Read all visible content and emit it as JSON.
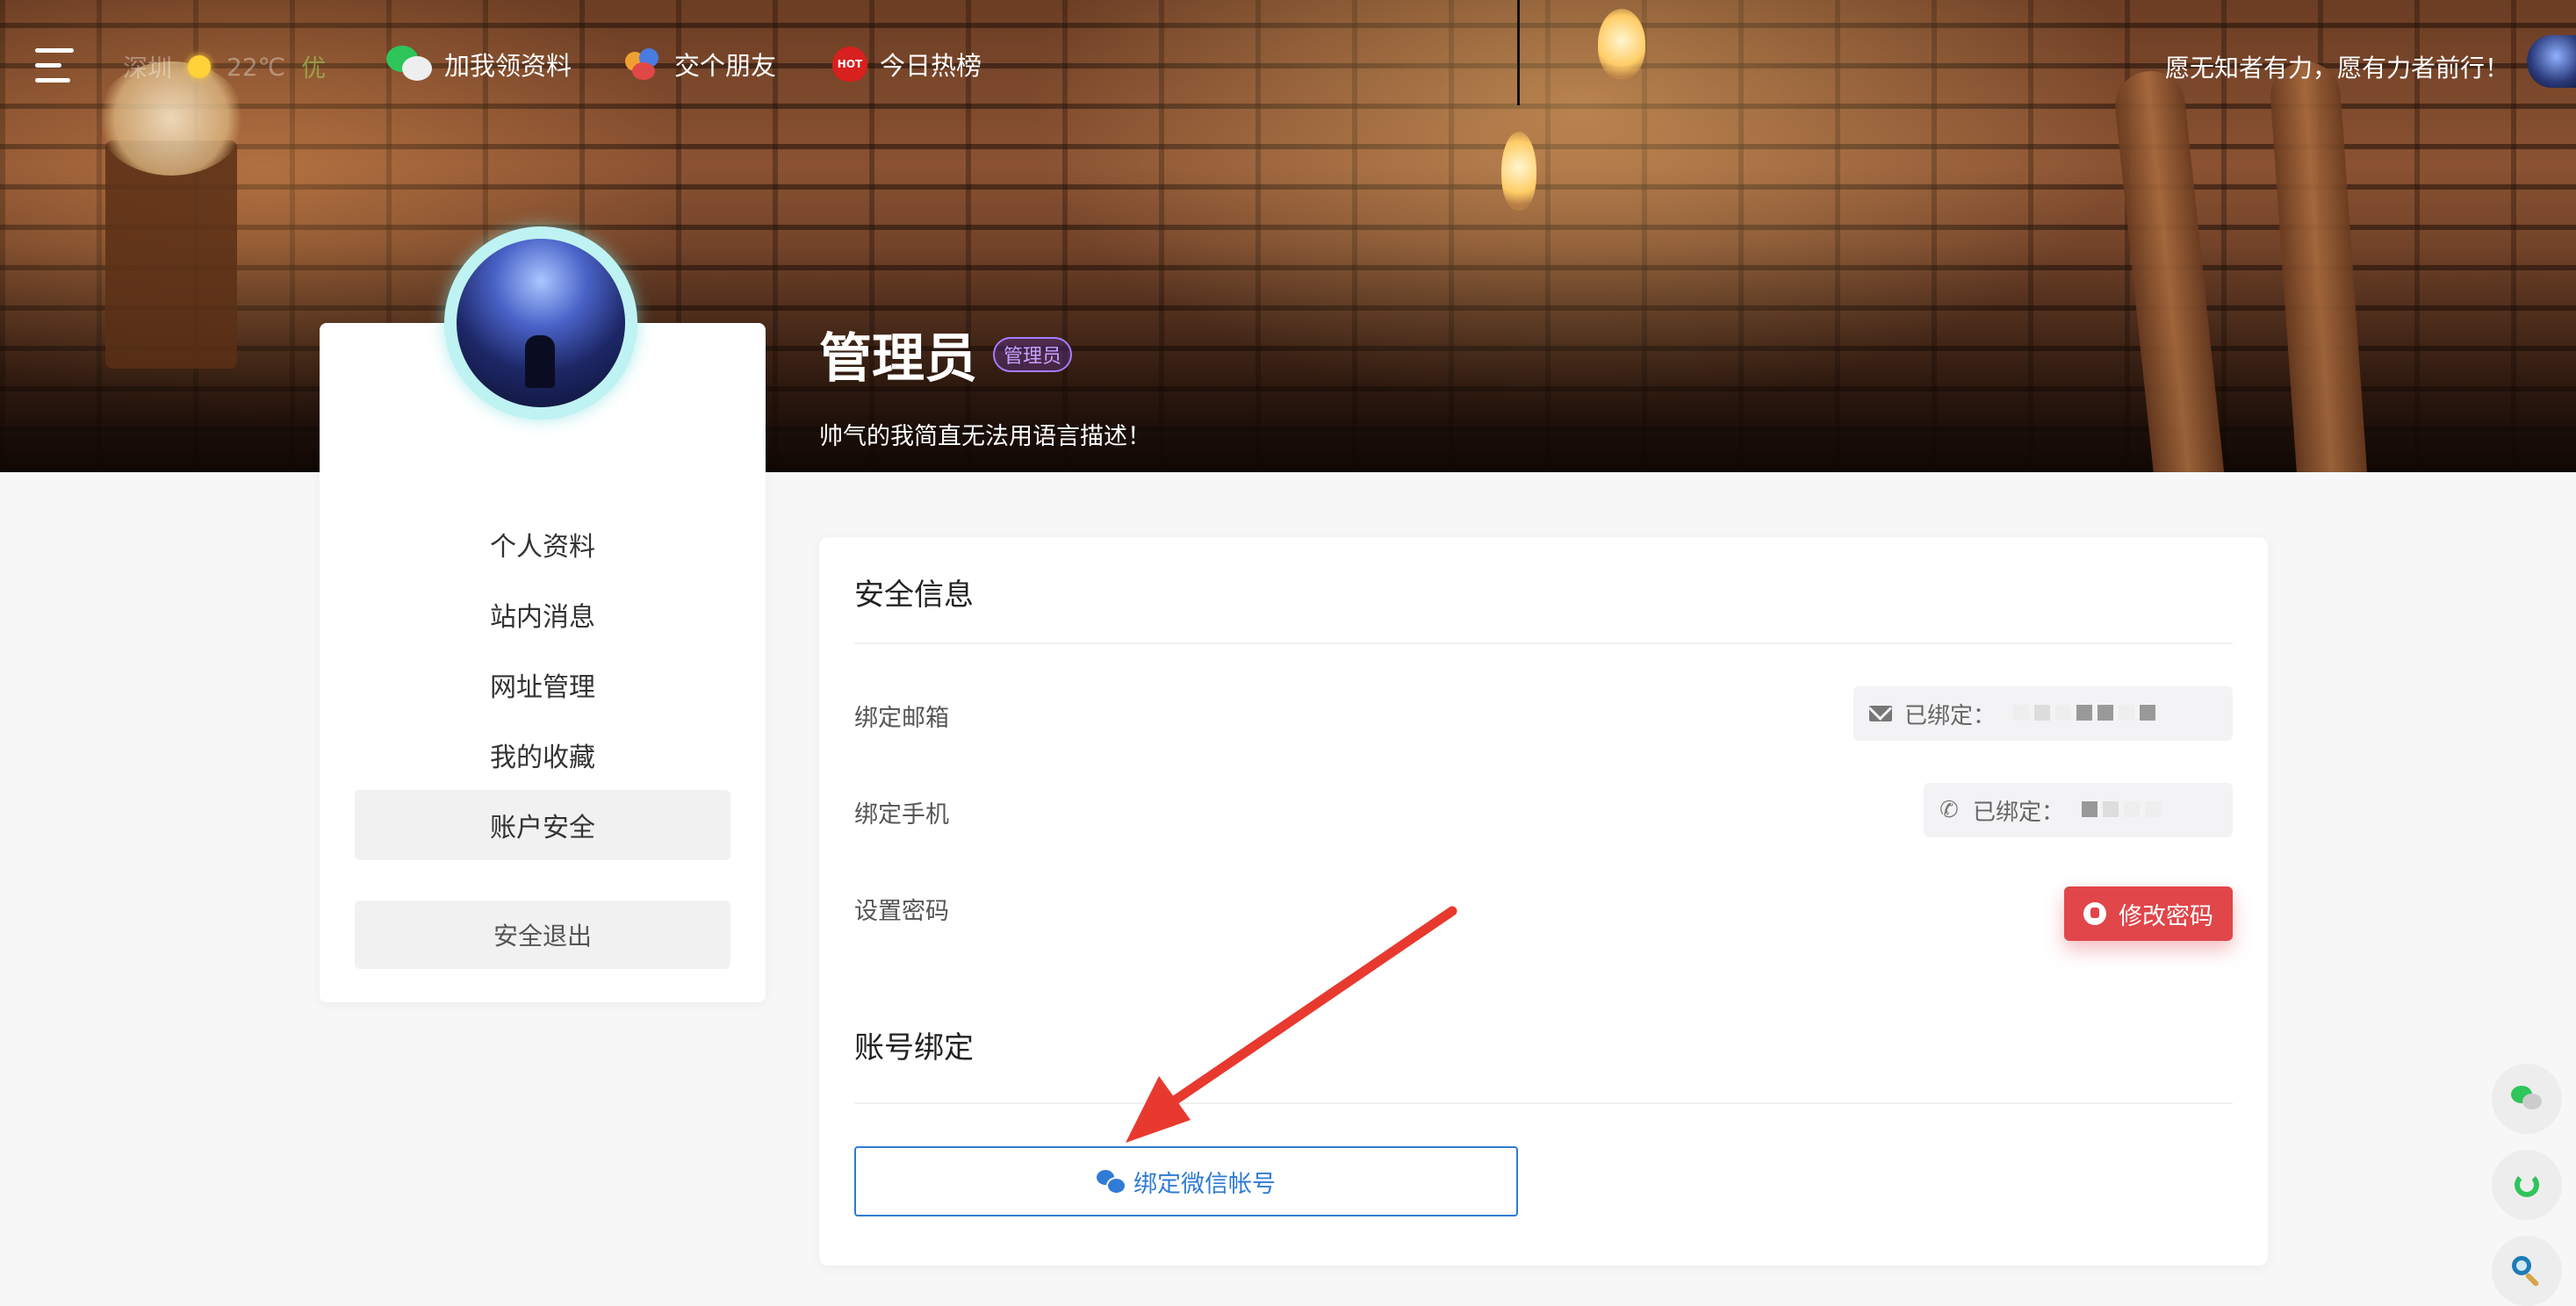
{
  "topnav": {
    "weather": {
      "city": "深圳",
      "temp": "22℃",
      "air": "优"
    },
    "links": [
      {
        "label": "加我领资料",
        "icon": "wechat-icon"
      },
      {
        "label": "交个朋友",
        "icon": "friends-icon"
      },
      {
        "label": "今日热榜",
        "icon": "hot-icon",
        "badge": "HOT"
      }
    ],
    "motto": "愿无知者有力，愿有力者前行！"
  },
  "hero": {
    "name": "管理员",
    "role_badge": "管理员",
    "signature": "帅气的我简直无法用语言描述！"
  },
  "sidebar": {
    "items": [
      {
        "label": "个人资料"
      },
      {
        "label": "站内消息"
      },
      {
        "label": "网址管理"
      },
      {
        "label": "我的收藏"
      },
      {
        "label": "账户安全"
      }
    ],
    "active_index": 4,
    "logout_label": "安全退出"
  },
  "main": {
    "security_title": "安全信息",
    "email": {
      "label": "绑定邮箱",
      "status": "已绑定："
    },
    "phone": {
      "label": "绑定手机",
      "status": "已绑定："
    },
    "password": {
      "label": "设置密码",
      "button_label": "修改密码"
    },
    "binding_title": "账号绑定",
    "wechat_bind_label": "绑定微信帐号"
  },
  "colors": {
    "danger": "#e0464a",
    "primary": "#2f7bd6",
    "annotation_arrow": "#e8392f"
  }
}
